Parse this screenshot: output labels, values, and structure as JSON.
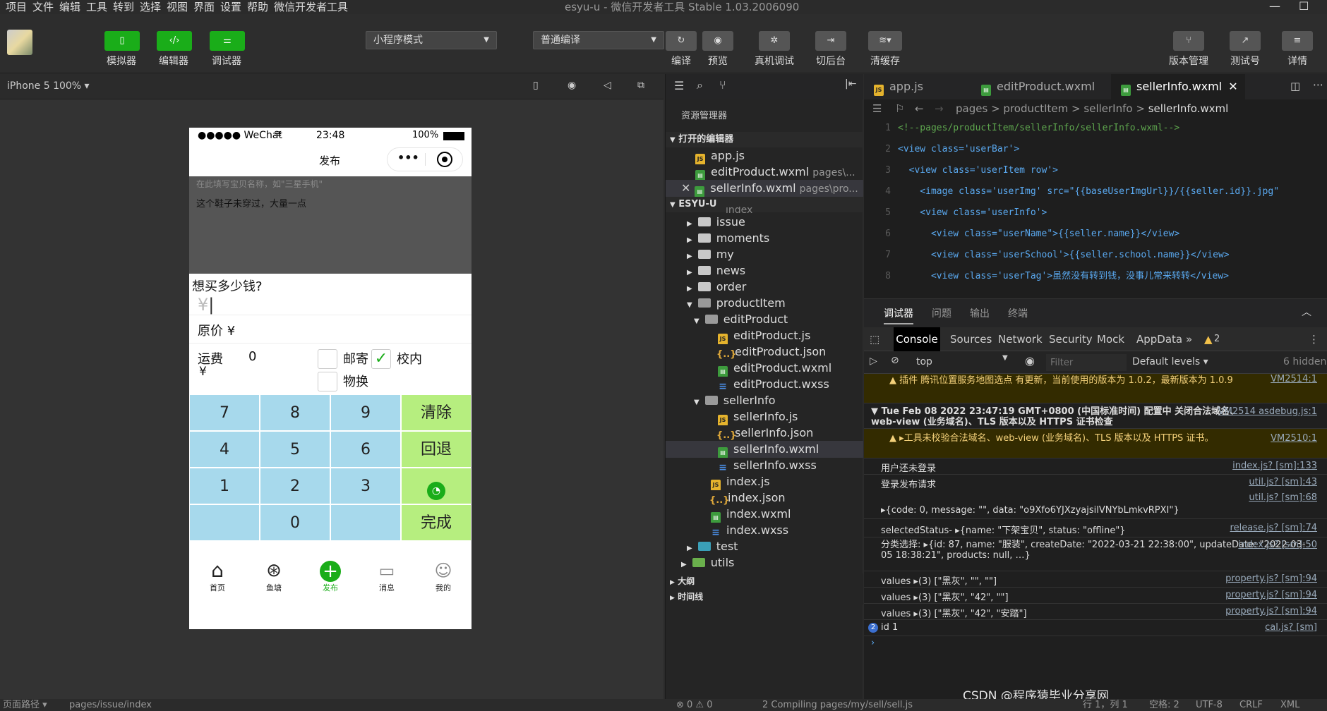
{
  "menu": [
    "项目",
    "文件",
    "编辑",
    "工具",
    "转到",
    "选择",
    "视图",
    "界面",
    "设置",
    "帮助",
    "微信开发者工具"
  ],
  "window_title": "esyu-u - 微信开发者工具 Stable 1.03.2006090",
  "toolbar": {
    "simulator": "模拟器",
    "editor": "编辑器",
    "debugger": "调试器",
    "mode_select": "小程序模式",
    "compile_select": "普通编译",
    "compile": "编译",
    "preview": "预览",
    "real_debug": "真机调试",
    "background": "切后台",
    "clear_cache": "清缓存",
    "version": "版本管理",
    "test_account": "测试号",
    "details": "详情"
  },
  "simbar": {
    "device": "iPhone 5 100% ▾"
  },
  "phone": {
    "status": {
      "carrier": "●●●●● WeChat",
      "time": "23:48",
      "battery": "100%"
    },
    "nav_title": "发布",
    "title_placeholder": "在此填写宝贝名称，如\"三星手机\"",
    "desc_text": "这个鞋子未穿过，大量一点",
    "price_question": "想买多少钱?",
    "price_symbol": "¥",
    "original_price_label": "原价 ¥",
    "shipping_label": "运费",
    "shipping_yen": "¥",
    "shipping_value": "0",
    "opt_mail": "邮寄",
    "opt_campus": "校内",
    "opt_exchange": "物换",
    "keys": [
      "7",
      "8",
      "9",
      "清除",
      "4",
      "5",
      "6",
      "回退",
      "1",
      "2",
      "3",
      "",
      "",
      "0",
      "",
      "完成"
    ],
    "tabs": [
      "首页",
      "鱼塘",
      "发布",
      "消息",
      "我的"
    ]
  },
  "explorer": {
    "title": "资源管理器",
    "open_editors": "打开的编辑器",
    "open_files": [
      {
        "name": "app.js",
        "path": ""
      },
      {
        "name": "editProduct.wxml",
        "path": "pages\\..."
      },
      {
        "name": "sellerInfo.wxml",
        "path": "pages\\pro..."
      }
    ],
    "project": "ESYU-U",
    "partial": "index",
    "folders": [
      "issue",
      "moments",
      "my",
      "news",
      "order",
      "productItem"
    ],
    "editProduct": "editProduct",
    "editProduct_files": [
      "editProduct.js",
      "editProduct.json",
      "editProduct.wxml",
      "editProduct.wxss"
    ],
    "sellerInfo": "sellerInfo",
    "sellerInfo_files": [
      "sellerInfo.js",
      "sellerInfo.json",
      "sellerInfo.wxml",
      "sellerInfo.wxss"
    ],
    "index_files": [
      "index.js",
      "index.json",
      "index.wxml",
      "index.wxss"
    ],
    "test": "test",
    "utils": "utils",
    "outline": "大纲",
    "timeline": "时间线"
  },
  "editor": {
    "tabs": [
      "app.js",
      "editProduct.wxml",
      "sellerInfo.wxml"
    ],
    "breadcrumb": [
      "pages",
      ">",
      "productItem",
      ">",
      "sellerInfo",
      ">",
      "sellerInfo.wxml"
    ],
    "lines": [
      {
        "n": "1",
        "t": "<!--pages/productItem/sellerInfo/sellerInfo.wxml-->"
      },
      {
        "n": "2",
        "t": "<view class='userBar'>"
      },
      {
        "n": "3",
        "t": "  <view class='userItem row'>"
      },
      {
        "n": "4",
        "t": "    <image class='userImg' src=\"{{baseUserImgUrl}}/{{seller.id}}.jpg\""
      },
      {
        "n": "5",
        "t": "    <view class='userInfo'>"
      },
      {
        "n": "6",
        "t": "      <view class=\"userName\">{{seller.name}}</view>"
      },
      {
        "n": "7",
        "t": "      <view class='userSchool'>{{seller.school.name}}</view>"
      },
      {
        "n": "8",
        "t": "      <view class='userTag'>虽然没有转到钱，没事儿常来转转</view>"
      }
    ]
  },
  "debug": {
    "tabs": [
      "调试器",
      "问题",
      "输出",
      "终端"
    ],
    "console_tabs": [
      "Console",
      "Sources",
      "Network",
      "Security",
      "Mock",
      "AppData",
      "»"
    ],
    "warn_count": "2",
    "context": "top",
    "filter_placeholder": "Filter",
    "levels": "Default levels ▾",
    "hidden": "6 hidden",
    "logs": [
      {
        "text": "▲ 插件 腾讯位置服务地图选点 有更新，当前使用的版本为 1.0.2，最新版本为 1.0.9",
        "src": "VM2514:1",
        "kind": "warn"
      },
      {
        "text": "▼ Tue Feb 08 2022 23:47:19 GMT+0800 (中国标准时间) 配置中 关闭合法域名、web-view (业务域名)、TLS 版本以及 HTTPS 证书检查",
        "src": "VM2514 asdebug.js:1",
        "kind": "info"
      },
      {
        "text": "▲ ▸工具未校验合法域名、web-view (业务域名)、TLS 版本以及 HTTPS 证书。",
        "src": "VM2510:1",
        "kind": "warn"
      },
      {
        "text": "用户还未登录",
        "src": "index.js? [sm]:133",
        "kind": "log"
      },
      {
        "text": "登录发布请求",
        "src": "util.js? [sm]:43",
        "kind": "log"
      },
      {
        "text": "▸{code: 0, message: \"\", data: \"o9Xfo6YJXzyajsilVNYbLmkvRPXI\"}",
        "src": "util.js? [sm]:68",
        "kind": "log"
      },
      {
        "text": "selectedStatus- ▸{name: \"下架宝贝\", status: \"offline\"}",
        "src": "release.js? [sm]:74",
        "kind": "log"
      },
      {
        "text": "分类选择: ▸{id: 87, name: \"服装\", createDate: \"2022-03-21 22:38:00\", updateDate: \"2022-03-05 18:38:21\", products: null, …}",
        "src": "index.js? [sm]:50",
        "kind": "log"
      },
      {
        "text": "values ▸(3) [\"黑灰\", \"\", \"\"]",
        "src": "property.js? [sm]:94",
        "kind": "log"
      },
      {
        "text": "values ▸(3) [\"黑灰\", \"42\", \"\"]",
        "src": "property.js? [sm]:94",
        "kind": "log"
      },
      {
        "text": "values ▸(3) [\"黑灰\", \"42\", \"安踏\"]",
        "src": "property.js? [sm]:94",
        "kind": "log"
      },
      {
        "text": "id 1",
        "src": "cal.js? [sm]",
        "kind": "log"
      }
    ]
  },
  "statusbar": {
    "path_label": "页面路径 ▾",
    "path": "pages/issue/index",
    "errors": "⊗ 0 ⚠ 0",
    "compiling": "2 Compiling pages/my/sell/sell.js",
    "cursor": "行 1，列 1",
    "spaces": "空格: 2",
    "encoding": "UTF-8",
    "eol": "CRLF",
    "lang": "XML"
  },
  "watermark": "CSDN @程序猿毕业分享网",
  "colors": {
    "green": "#1aad19",
    "keypad_blue": "#a7d9ec",
    "keypad_green": "#b6ee7f"
  }
}
